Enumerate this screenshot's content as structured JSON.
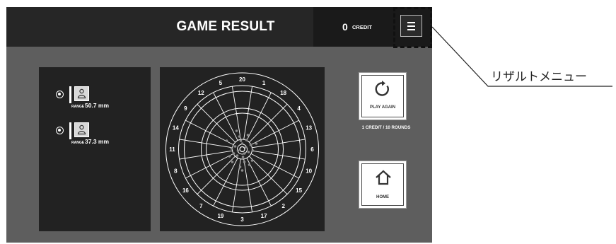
{
  "header": {
    "title": "GAME RESULT",
    "credit_count": "0",
    "credit_label": "CREDIT"
  },
  "players": [
    {
      "range_label": "RANGE",
      "range_value": "50.7 mm"
    },
    {
      "range_label": "RANGE",
      "range_value": "37.3 mm"
    }
  ],
  "dartboard": {
    "numbers": [
      "20",
      "1",
      "18",
      "4",
      "13",
      "6",
      "10",
      "15",
      "2",
      "17",
      "3",
      "19",
      "7",
      "16",
      "8",
      "11",
      "14",
      "9",
      "12",
      "5"
    ]
  },
  "actions": {
    "play_again_label": "PLAY AGAIN",
    "play_again_sub": "1 CREDIT / 10 ROUNDS",
    "home_label": "HOME"
  },
  "annotation": {
    "label": "リザルトメニュー"
  },
  "colors": {
    "screen_bg": "#5e5e5e",
    "topbar_bg": "#262626",
    "panel_bg": "#222222"
  }
}
